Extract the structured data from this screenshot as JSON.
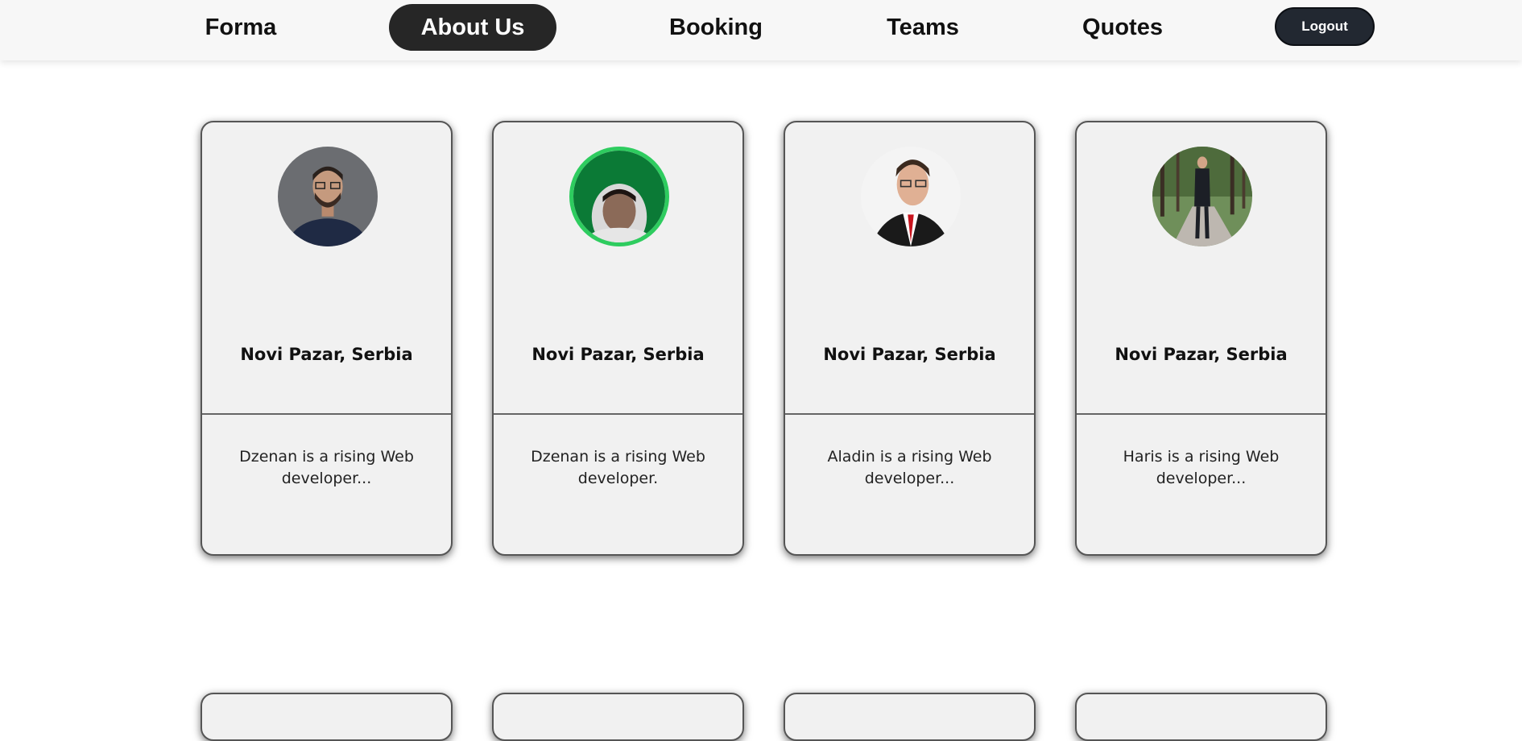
{
  "nav": {
    "links": [
      {
        "label": "Forma"
      },
      {
        "label": "About Us",
        "active": true
      },
      {
        "label": "Booking"
      },
      {
        "label": "Teams"
      },
      {
        "label": "Quotes"
      }
    ],
    "logout_label": "Logout"
  },
  "cards": [
    {
      "location": "Novi Pazar, Serbia",
      "bio": "Dzenan is a rising Web developer..."
    },
    {
      "location": "Novi Pazar, Serbia",
      "bio": "Dzenan is a rising Web developer."
    },
    {
      "location": "Novi Pazar, Serbia",
      "bio": "Aladin is a rising Web developer..."
    },
    {
      "location": "Novi Pazar, Serbia",
      "bio": "Haris is a rising Web developer..."
    }
  ],
  "colors": {
    "nav_bg": "#f7f7f7",
    "active_pill": "#262626",
    "logout_bg": "#222831",
    "card_bg": "#f1f1f1",
    "avatar_ring": "#2ecc5f"
  }
}
